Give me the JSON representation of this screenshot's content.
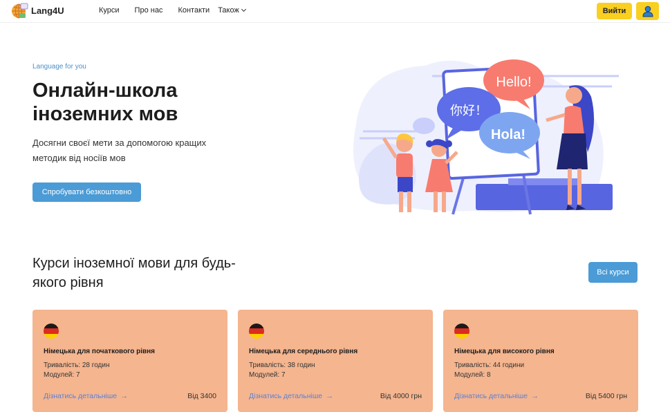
{
  "header": {
    "logo_text": "Lang4U",
    "nav": [
      "Курси",
      "Про нас",
      "Контакти"
    ],
    "more_label": "Також",
    "login_label": "Вийти"
  },
  "hero": {
    "eyebrow": "Language for you",
    "title": "Онлайн-школа іноземних мов",
    "subtitle": "Досягни своєї мети за допомогою кращих методик від носіїв мов",
    "cta": "Спробувати безкоштовно",
    "bubbles": [
      "Hello!",
      "你好！",
      "Hola!"
    ]
  },
  "courses": {
    "title": "Курси іноземної мови для будь-якого рівня",
    "all_label": "Всі курси",
    "items": [
      {
        "title": "Німецька для початкового рівня",
        "duration": "Тривалість: 28 годин",
        "modules": "Модулей: 7",
        "link": "Дізнатись детальніше",
        "price": "Від 3400"
      },
      {
        "title": "Німецька для середнього рівня",
        "duration": "Тривалість: 38 годин",
        "modules": "Модулей: 7",
        "link": "Дізнатись детальніше",
        "price": "Від 4000 грн"
      },
      {
        "title": "Німецька для високого рівня",
        "duration": "Тривалість: 44 години",
        "modules": "Модулей: 8",
        "link": "Дізнатись детальніше",
        "price": "Від 5400 грн"
      }
    ]
  },
  "colors": {
    "accent_yellow": "#f9cf22",
    "accent_blue": "#4a9bd6",
    "card_bg": "#f4b58f",
    "link": "#5b7fd6"
  }
}
